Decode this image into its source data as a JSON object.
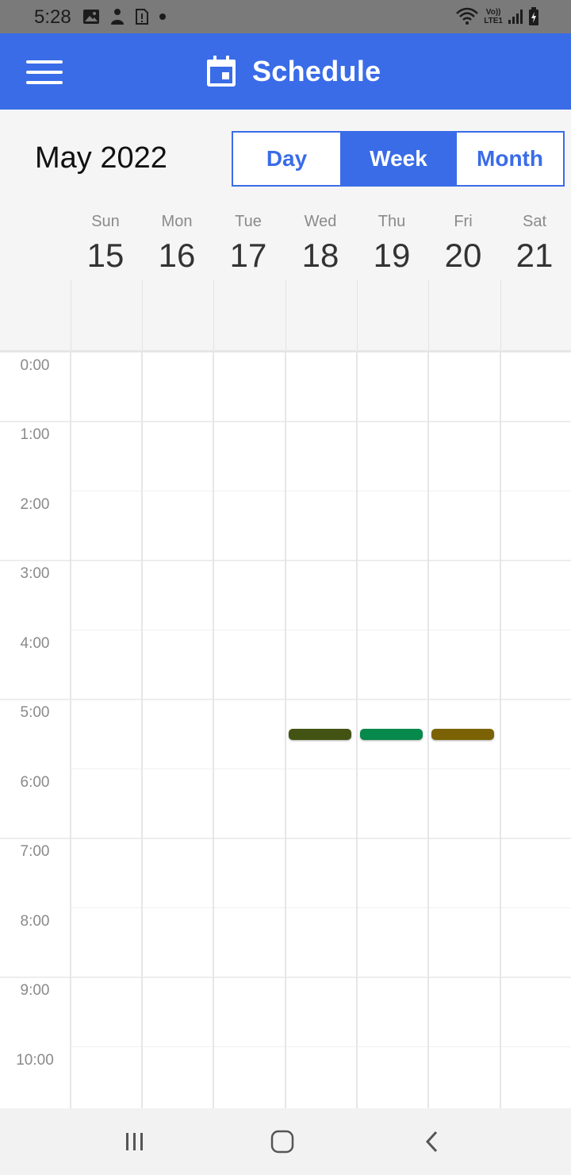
{
  "status_bar": {
    "time": "5:28",
    "left_icons": [
      "image-icon",
      "person-icon",
      "sim-alert-icon",
      "dot-icon"
    ],
    "right_icons": [
      "wifi-icon",
      "volte-icon",
      "signal-icon",
      "battery-charging-icon"
    ],
    "volte_label_top": "Vo))",
    "volte_label_bottom": "LTE1"
  },
  "app_bar": {
    "title": "Schedule",
    "menu_icon": "hamburger-menu-icon",
    "title_icon": "calendar-icon",
    "color": "#3a6ce8"
  },
  "calendar": {
    "month_label": "May 2022",
    "view_options": [
      {
        "label": "Day",
        "active": false
      },
      {
        "label": "Week",
        "active": true
      },
      {
        "label": "Month",
        "active": false
      }
    ],
    "days": [
      {
        "name": "Sun",
        "date": "15"
      },
      {
        "name": "Mon",
        "date": "16"
      },
      {
        "name": "Tue",
        "date": "17"
      },
      {
        "name": "Wed",
        "date": "18"
      },
      {
        "name": "Thu",
        "date": "19"
      },
      {
        "name": "Fri",
        "date": "20"
      },
      {
        "name": "Sat",
        "date": "21"
      }
    ],
    "hours": [
      "0:00",
      "1:00",
      "2:00",
      "3:00",
      "4:00",
      "5:00",
      "6:00",
      "7:00",
      "8:00",
      "9:00",
      "10:00"
    ],
    "events": [
      {
        "day_index": 3,
        "start_hour": 5.5,
        "color": "#435313"
      },
      {
        "day_index": 4,
        "start_hour": 5.5,
        "color": "#06894b"
      },
      {
        "day_index": 5,
        "start_hour": 5.5,
        "color": "#7b6305"
      }
    ]
  },
  "nav_bar": {
    "buttons": [
      "recent-apps-icon",
      "home-icon",
      "back-icon"
    ]
  }
}
